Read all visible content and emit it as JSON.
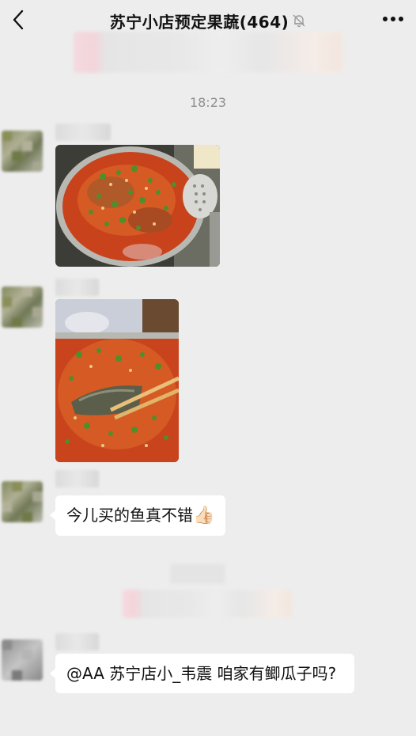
{
  "header": {
    "title": "苏宁小店预定果蔬",
    "member_count": "(464)",
    "back_icon": "chevron-left-icon",
    "mute_icon": "bell-off-icon",
    "more_icon": "ellipsis-icon"
  },
  "timestamp": "18:23",
  "messages": [
    {
      "type": "image",
      "image_desc": "food-photo-fish-hotpot"
    },
    {
      "type": "image",
      "image_desc": "food-photo-fish-chopsticks"
    },
    {
      "type": "text",
      "text": "今儿买的鱼真不错",
      "emoji": "👍🏻"
    },
    {
      "type": "text",
      "text": "@AA 苏宁店小_韦震 咱家有鲫瓜子吗?"
    }
  ],
  "colors": {
    "background": "#ededed",
    "bubble": "#ffffff",
    "timestamp": "#8f8f8f"
  }
}
